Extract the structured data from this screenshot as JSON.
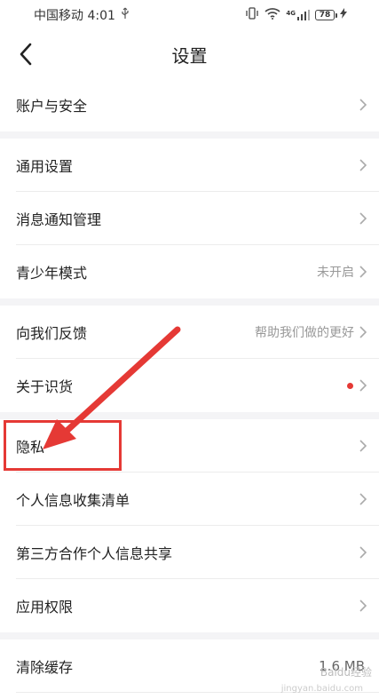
{
  "status_bar": {
    "carrier_time": "中国移动 4:01",
    "usb_icon": "usb-icon",
    "network": "4G",
    "battery": "78"
  },
  "header": {
    "title": "设置",
    "back_icon": "back-icon"
  },
  "rows": {
    "account_security": {
      "label": "账户与安全"
    },
    "general": {
      "label": "通用设置"
    },
    "notifications": {
      "label": "消息通知管理"
    },
    "youth_mode": {
      "label": "青少年模式",
      "value": "未开启"
    },
    "feedback": {
      "label": "向我们反馈",
      "value": "帮助我们做的更好"
    },
    "about": {
      "label": "关于识货"
    },
    "privacy": {
      "label": "隐私"
    },
    "personal_info": {
      "label": "个人信息收集清单"
    },
    "third_party": {
      "label": "第三方合作个人信息共享"
    },
    "app_permissions": {
      "label": "应用权限"
    },
    "clear_cache": {
      "label": "清除缓存",
      "value": "1.6 MB"
    }
  },
  "annotation": {
    "color": "#e53935"
  },
  "watermark": {
    "text": "Baidu经验",
    "url": "jingyan.baidu.com"
  }
}
